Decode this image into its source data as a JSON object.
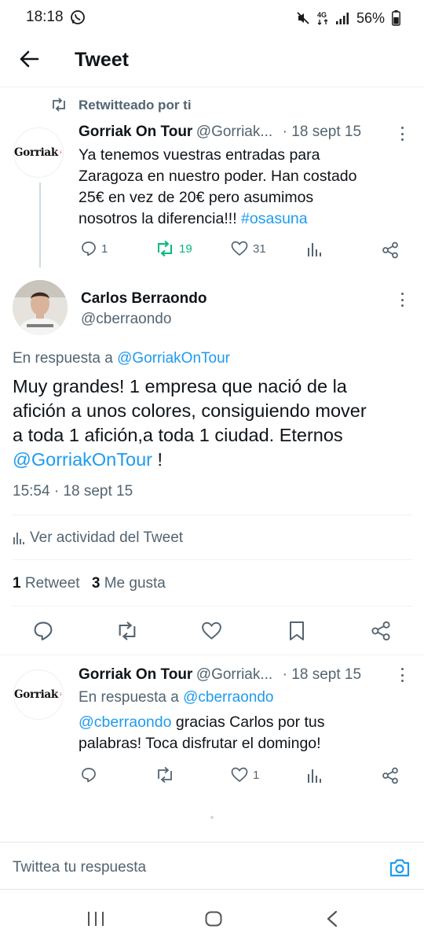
{
  "status_bar": {
    "time": "18:18",
    "battery": "56%",
    "network": "4G"
  },
  "header": {
    "title": "Tweet"
  },
  "retweet_banner": {
    "label": "Retwitteado por ti"
  },
  "parent_tweet": {
    "name": "Gorriak On Tour",
    "handle": "@Gorriak...",
    "date": "· 18 sept 15",
    "avatar_text": "Gorriak",
    "text_line1": "Ya tenemos vuestras entradas para",
    "text_line2": "Zaragoza en nuestro poder. Han costado",
    "text_line3": "25€ en vez de 20€ pero asumimos",
    "text_line4_prefix": "nosotros la diferencia!!!",
    "hashtag": "#osasuna",
    "replies": "1",
    "retweets": "19",
    "likes": "31"
  },
  "main_tweet": {
    "name": "Carlos Berraondo",
    "handle": "@cberraondo",
    "reply_to_label": "En respuesta a",
    "reply_to_handle": "@GorriakOnTour",
    "text_line1": "Muy grandes! 1 empresa que nació de la",
    "text_line2": "afición a unos colores, consiguiendo mover",
    "text_line3": "a toda 1 afición,a toda 1 ciudad. Eternos",
    "mention": "@GorriakOnTour",
    "text_end": " !",
    "timestamp": "15:54 · 18 sept 15",
    "activity_label": "Ver actividad del Tweet",
    "retweet_count": "1",
    "retweet_label": "Retweet",
    "like_count": "3",
    "like_label": "Me gusta"
  },
  "reply_tweet": {
    "name": "Gorriak On Tour",
    "handle": "@Gorriak...",
    "date": "· 18 sept 15",
    "reply_to_label": "En respuesta a",
    "reply_to_handle": "@cberraondo",
    "mention": "@cberraondo",
    "text_line1_rest": " gracias Carlos por tus",
    "text_line2": "palabras! Toca disfrutar el domingo!",
    "likes": "1"
  },
  "composer": {
    "placeholder": "Twittea tu respuesta"
  },
  "colors": {
    "accent": "#1d9bf0",
    "retweet_green": "#00ba7c",
    "muted": "#536471",
    "text": "#0f1419"
  }
}
